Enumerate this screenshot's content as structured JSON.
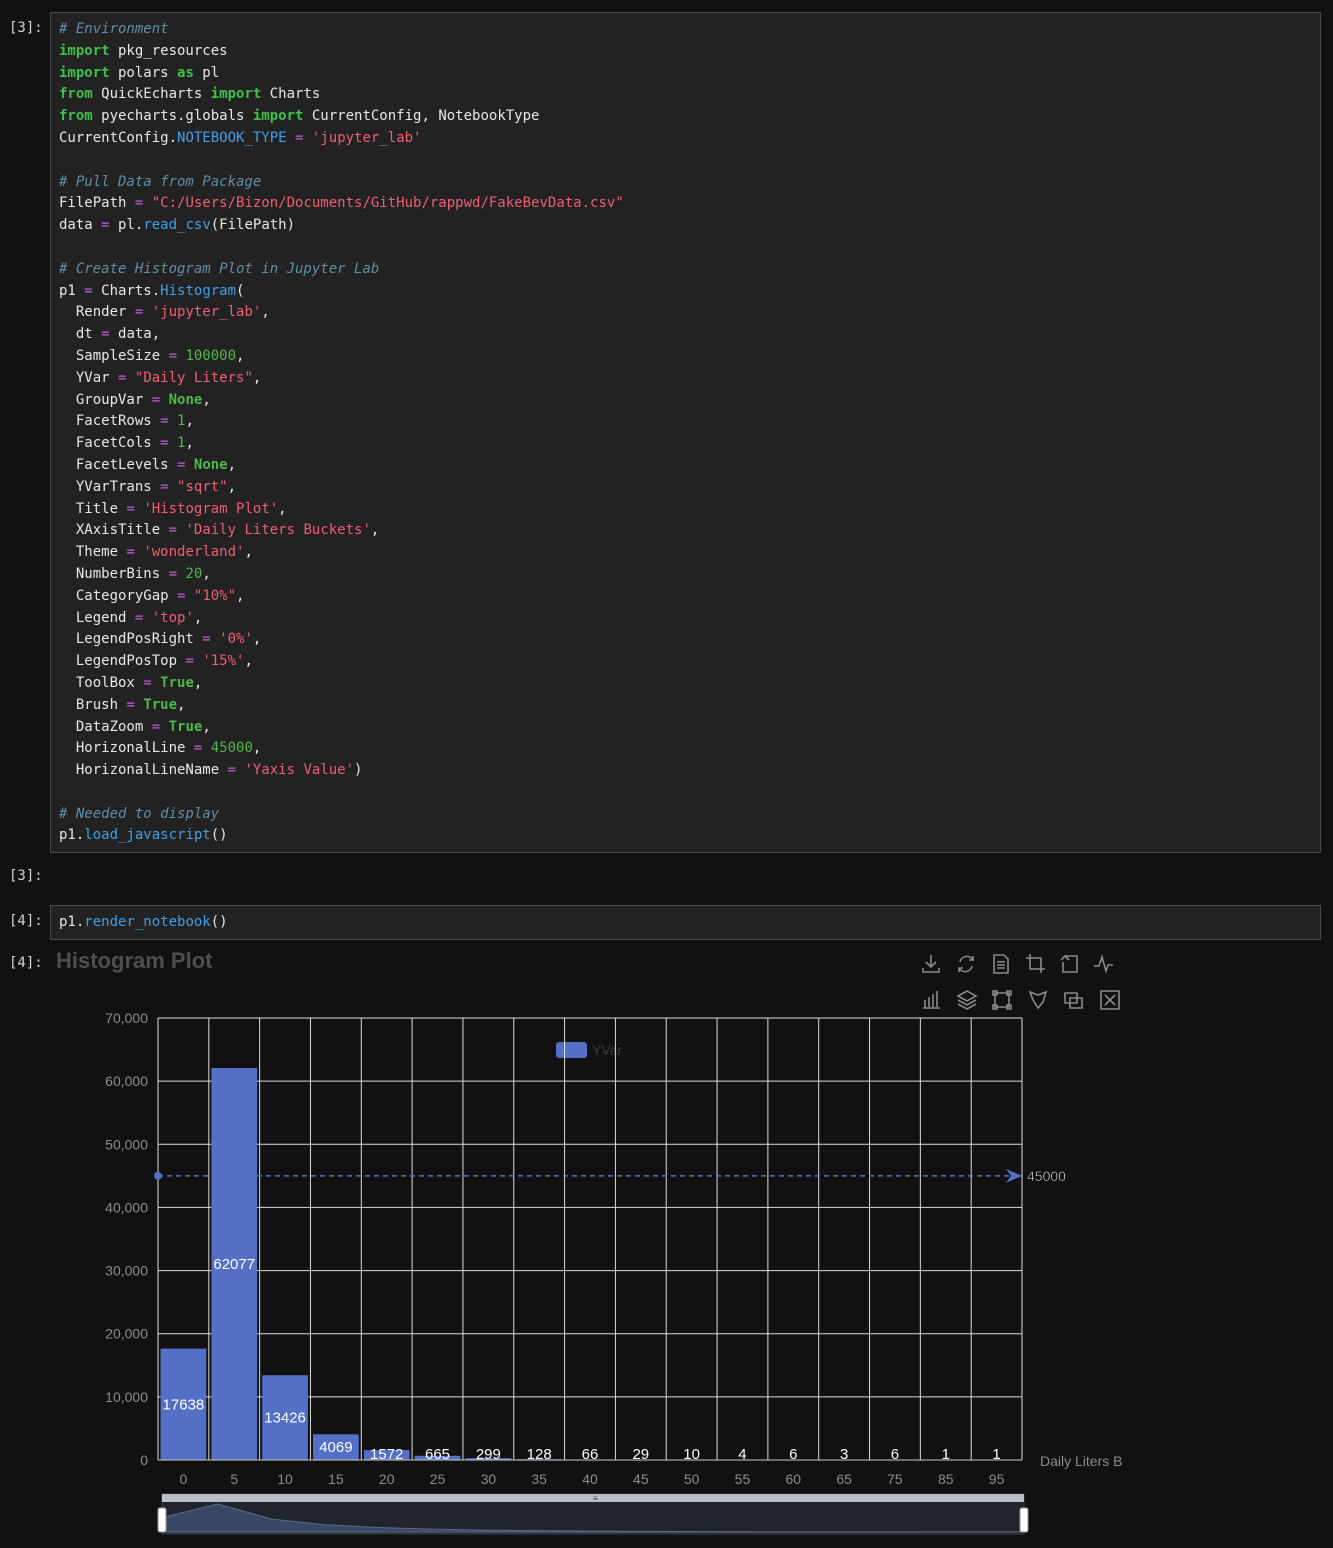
{
  "cells": [
    {
      "prompt": "[3]:"
    },
    {
      "prompt": "[3]:"
    },
    {
      "prompt": "[4]:",
      "code": "p1.render_notebook()"
    },
    {
      "prompt": "[4]:"
    }
  ],
  "code_lines": [
    [
      [
        "t-cm",
        "# Environment"
      ]
    ],
    [
      [
        "t-kw",
        "import"
      ],
      [
        "t-id",
        " pkg_resources"
      ]
    ],
    [
      [
        "t-kw",
        "import"
      ],
      [
        "t-id",
        " polars "
      ],
      [
        "t-kw",
        "as"
      ],
      [
        "t-id",
        " pl"
      ]
    ],
    [
      [
        "t-kw",
        "from"
      ],
      [
        "t-id",
        " QuickEcharts "
      ],
      [
        "t-kw",
        "import"
      ],
      [
        "t-id",
        " Charts"
      ]
    ],
    [
      [
        "t-kw",
        "from"
      ],
      [
        "t-id",
        " pyecharts.globals "
      ],
      [
        "t-kw",
        "import"
      ],
      [
        "t-id",
        " CurrentConfig, NotebookType"
      ]
    ],
    [
      [
        "t-id",
        "CurrentConfig."
      ],
      [
        "t-at",
        "NOTEBOOK_TYPE"
      ],
      [
        "t-id",
        " "
      ],
      [
        "t-op",
        "="
      ],
      [
        "t-id",
        " "
      ],
      [
        "t-st",
        "'jupyter_lab'"
      ]
    ],
    [],
    [
      [
        "t-cm",
        "# Pull Data from Package"
      ]
    ],
    [
      [
        "t-id",
        "FilePath "
      ],
      [
        "t-op",
        "="
      ],
      [
        "t-id",
        " "
      ],
      [
        "t-st",
        "\"C:/Users/Bizon/Documents/GitHub/rappwd/FakeBevData.csv\""
      ]
    ],
    [
      [
        "t-id",
        "data "
      ],
      [
        "t-op",
        "="
      ],
      [
        "t-id",
        " pl."
      ],
      [
        "t-fn",
        "read_csv"
      ],
      [
        "t-id",
        "(FilePath)"
      ]
    ],
    [],
    [
      [
        "t-cm",
        "# Create Histogram Plot in Jupyter Lab"
      ]
    ],
    [
      [
        "t-id",
        "p1 "
      ],
      [
        "t-op",
        "="
      ],
      [
        "t-id",
        " Charts."
      ],
      [
        "t-fn",
        "Histogram"
      ],
      [
        "t-id",
        "("
      ]
    ],
    [
      [
        "t-id",
        "  Render "
      ],
      [
        "t-op",
        "="
      ],
      [
        "t-id",
        " "
      ],
      [
        "t-st",
        "'jupyter_lab'"
      ],
      [
        "t-id",
        ","
      ]
    ],
    [
      [
        "t-id",
        "  dt "
      ],
      [
        "t-op",
        "="
      ],
      [
        "t-id",
        " data,"
      ]
    ],
    [
      [
        "t-id",
        "  SampleSize "
      ],
      [
        "t-op",
        "="
      ],
      [
        "t-id",
        " "
      ],
      [
        "t-nu",
        "100000"
      ],
      [
        "t-id",
        ","
      ]
    ],
    [
      [
        "t-id",
        "  YVar "
      ],
      [
        "t-op",
        "="
      ],
      [
        "t-id",
        " "
      ],
      [
        "t-st",
        "\"Daily Liters\""
      ],
      [
        "t-id",
        ","
      ]
    ],
    [
      [
        "t-id",
        "  GroupVar "
      ],
      [
        "t-op",
        "="
      ],
      [
        "t-id",
        " "
      ],
      [
        "t-bl",
        "None"
      ],
      [
        "t-id",
        ","
      ]
    ],
    [
      [
        "t-id",
        "  FacetRows "
      ],
      [
        "t-op",
        "="
      ],
      [
        "t-id",
        " "
      ],
      [
        "t-nu",
        "1"
      ],
      [
        "t-id",
        ","
      ]
    ],
    [
      [
        "t-id",
        "  FacetCols "
      ],
      [
        "t-op",
        "="
      ],
      [
        "t-id",
        " "
      ],
      [
        "t-nu",
        "1"
      ],
      [
        "t-id",
        ","
      ]
    ],
    [
      [
        "t-id",
        "  FacetLevels "
      ],
      [
        "t-op",
        "="
      ],
      [
        "t-id",
        " "
      ],
      [
        "t-bl",
        "None"
      ],
      [
        "t-id",
        ","
      ]
    ],
    [
      [
        "t-id",
        "  YVarTrans "
      ],
      [
        "t-op",
        "="
      ],
      [
        "t-id",
        " "
      ],
      [
        "t-st",
        "\"sqrt\""
      ],
      [
        "t-id",
        ","
      ]
    ],
    [
      [
        "t-id",
        "  Title "
      ],
      [
        "t-op",
        "="
      ],
      [
        "t-id",
        " "
      ],
      [
        "t-st",
        "'Histogram Plot'"
      ],
      [
        "t-id",
        ","
      ]
    ],
    [
      [
        "t-id",
        "  XAxisTitle "
      ],
      [
        "t-op",
        "="
      ],
      [
        "t-id",
        " "
      ],
      [
        "t-st",
        "'Daily Liters Buckets'"
      ],
      [
        "t-id",
        ","
      ]
    ],
    [
      [
        "t-id",
        "  Theme "
      ],
      [
        "t-op",
        "="
      ],
      [
        "t-id",
        " "
      ],
      [
        "t-st",
        "'wonderland'"
      ],
      [
        "t-id",
        ","
      ]
    ],
    [
      [
        "t-id",
        "  NumberBins "
      ],
      [
        "t-op",
        "="
      ],
      [
        "t-id",
        " "
      ],
      [
        "t-nu",
        "20"
      ],
      [
        "t-id",
        ","
      ]
    ],
    [
      [
        "t-id",
        "  CategoryGap "
      ],
      [
        "t-op",
        "="
      ],
      [
        "t-id",
        " "
      ],
      [
        "t-st",
        "\"10%\""
      ],
      [
        "t-id",
        ","
      ]
    ],
    [
      [
        "t-id",
        "  Legend "
      ],
      [
        "t-op",
        "="
      ],
      [
        "t-id",
        " "
      ],
      [
        "t-st",
        "'top'"
      ],
      [
        "t-id",
        ","
      ]
    ],
    [
      [
        "t-id",
        "  LegendPosRight "
      ],
      [
        "t-op",
        "="
      ],
      [
        "t-id",
        " "
      ],
      [
        "t-st",
        "'0%'"
      ],
      [
        "t-id",
        ","
      ]
    ],
    [
      [
        "t-id",
        "  LegendPosTop "
      ],
      [
        "t-op",
        "="
      ],
      [
        "t-id",
        " "
      ],
      [
        "t-st",
        "'15%'"
      ],
      [
        "t-id",
        ","
      ]
    ],
    [
      [
        "t-id",
        "  ToolBox "
      ],
      [
        "t-op",
        "="
      ],
      [
        "t-id",
        " "
      ],
      [
        "t-bl",
        "True"
      ],
      [
        "t-id",
        ","
      ]
    ],
    [
      [
        "t-id",
        "  Brush "
      ],
      [
        "t-op",
        "="
      ],
      [
        "t-id",
        " "
      ],
      [
        "t-bl",
        "True"
      ],
      [
        "t-id",
        ","
      ]
    ],
    [
      [
        "t-id",
        "  DataZoom "
      ],
      [
        "t-op",
        "="
      ],
      [
        "t-id",
        " "
      ],
      [
        "t-bl",
        "True"
      ],
      [
        "t-id",
        ","
      ]
    ],
    [
      [
        "t-id",
        "  HorizonalLine "
      ],
      [
        "t-op",
        "="
      ],
      [
        "t-id",
        " "
      ],
      [
        "t-nu",
        "45000"
      ],
      [
        "t-id",
        ","
      ]
    ],
    [
      [
        "t-id",
        "  HorizonalLineName "
      ],
      [
        "t-op",
        "="
      ],
      [
        "t-id",
        " "
      ],
      [
        "t-st",
        "'Yaxis Value'"
      ],
      [
        "t-id",
        ")"
      ]
    ],
    [],
    [
      [
        "t-cm",
        "# Needed to display"
      ]
    ],
    [
      [
        "t-id",
        "p1."
      ],
      [
        "t-fn",
        "load_javascript"
      ],
      [
        "t-id",
        "()"
      ]
    ]
  ],
  "render_code": [
    [
      "t-id",
      "p1."
    ],
    [
      "t-fn",
      "render_notebook"
    ],
    [
      "t-id",
      "()"
    ]
  ],
  "chart_data": {
    "type": "bar",
    "title": "Histogram Plot",
    "xlabel": "Daily Liters B",
    "ylabel": "",
    "categories": [
      "0",
      "5",
      "10",
      "15",
      "20",
      "25",
      "30",
      "35",
      "40",
      "45",
      "50",
      "55",
      "60",
      "65",
      "75",
      "85",
      "95"
    ],
    "series": [
      {
        "name": "YVar",
        "values": [
          17638,
          62077,
          13426,
          4069,
          1572,
          665,
          299,
          128,
          66,
          29,
          10,
          4,
          6,
          3,
          6,
          1,
          1
        ]
      }
    ],
    "y_ticks": [
      "0",
      "10,000",
      "20,000",
      "30,000",
      "40,000",
      "50,000",
      "60,000",
      "70,000"
    ],
    "ylim": [
      0,
      70000
    ],
    "mark_line": {
      "value": 45000,
      "label": "45000"
    },
    "legend_position": "top",
    "grid": true,
    "colors": {
      "bar": "#5470c6",
      "grid": "#dddddd",
      "mark_line": "#5470c6"
    }
  },
  "toolbox": {
    "row1": [
      "download-icon",
      "restore-icon",
      "data-view-icon",
      "zoom-select-icon",
      "zoom-back-icon",
      "line-switch-icon"
    ],
    "row2": [
      "bar-switch-icon",
      "stack-switch-icon",
      "rect-brush-icon",
      "polygon-brush-icon",
      "keep-brush-icon",
      "clear-brush-icon"
    ]
  },
  "datazoom": {
    "grip_label": "≡"
  }
}
